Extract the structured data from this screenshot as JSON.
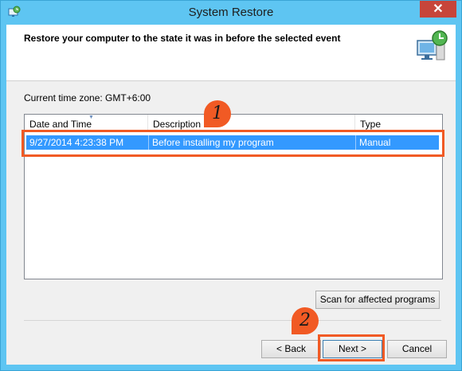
{
  "window": {
    "title": "System Restore",
    "close_glyph": "✕"
  },
  "header": {
    "text": "Restore your computer to the state it was in before the selected event"
  },
  "timezone_label": "Current time zone: GMT+6:00",
  "list": {
    "columns": [
      "Date and Time",
      "Description",
      "Type"
    ],
    "rows": [
      {
        "date_time": "9/27/2014 4:23:38 PM",
        "description": "Before installing my program",
        "type": "Manual",
        "selected": true
      }
    ]
  },
  "buttons": {
    "scan": "Scan for affected programs",
    "back": "< Back",
    "next": "Next >",
    "cancel": "Cancel"
  },
  "annotations": {
    "marker_1": "1",
    "marker_2": "2"
  },
  "icons": {
    "app": "system-restore-icon",
    "header": "computer-restore-icon",
    "close": "close-icon"
  },
  "colors": {
    "titlebar": "#5ec5f2",
    "selection": "#3399ff",
    "annotation": "#f15a24",
    "close": "#c7453a"
  }
}
